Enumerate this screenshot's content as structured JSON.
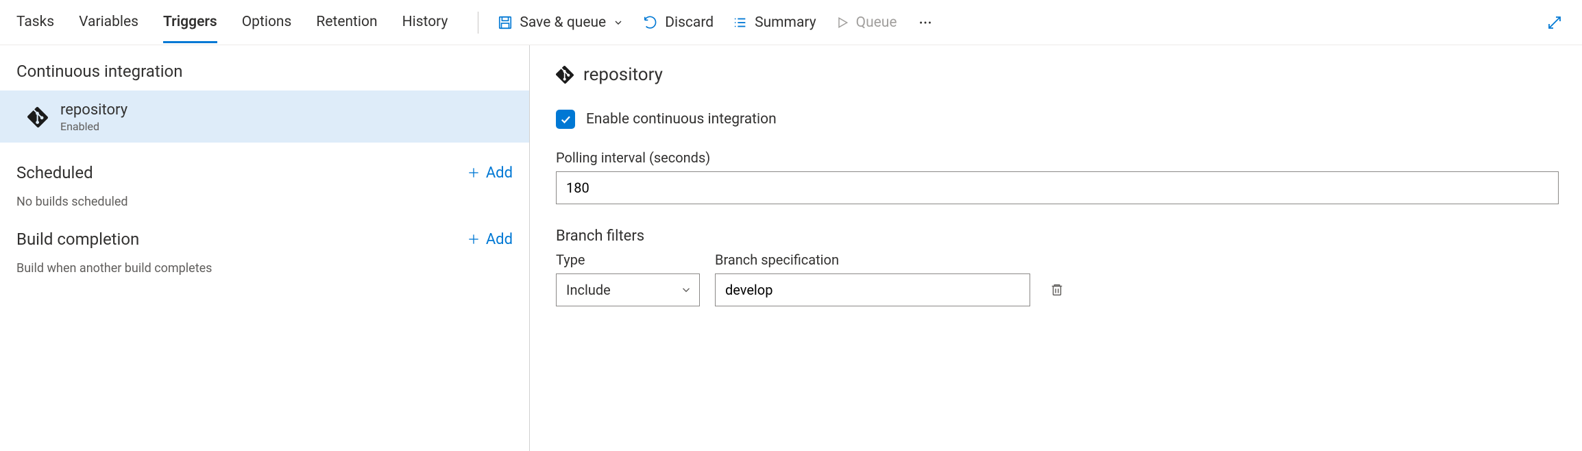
{
  "tabs": {
    "tasks": "Tasks",
    "variables": "Variables",
    "triggers": "Triggers",
    "options": "Options",
    "retention": "Retention",
    "history": "History"
  },
  "commands": {
    "save_queue": "Save & queue",
    "discard": "Discard",
    "summary": "Summary",
    "queue": "Queue"
  },
  "left": {
    "ci_heading": "Continuous integration",
    "ci_item_name": "repository",
    "ci_item_status": "Enabled",
    "scheduled_heading": "Scheduled",
    "scheduled_add": "Add",
    "scheduled_hint": "No builds scheduled",
    "buildcomp_heading": "Build completion",
    "buildcomp_add": "Add",
    "buildcomp_hint": "Build when another build completes"
  },
  "right": {
    "header": "repository",
    "enable_ci_label": "Enable continuous integration",
    "enable_ci_checked": true,
    "polling_label": "Polling interval (seconds)",
    "polling_value": "180",
    "branch_filters_heading": "Branch filters",
    "type_label": "Type",
    "type_value": "Include",
    "spec_label": "Branch specification",
    "spec_value": "develop"
  }
}
